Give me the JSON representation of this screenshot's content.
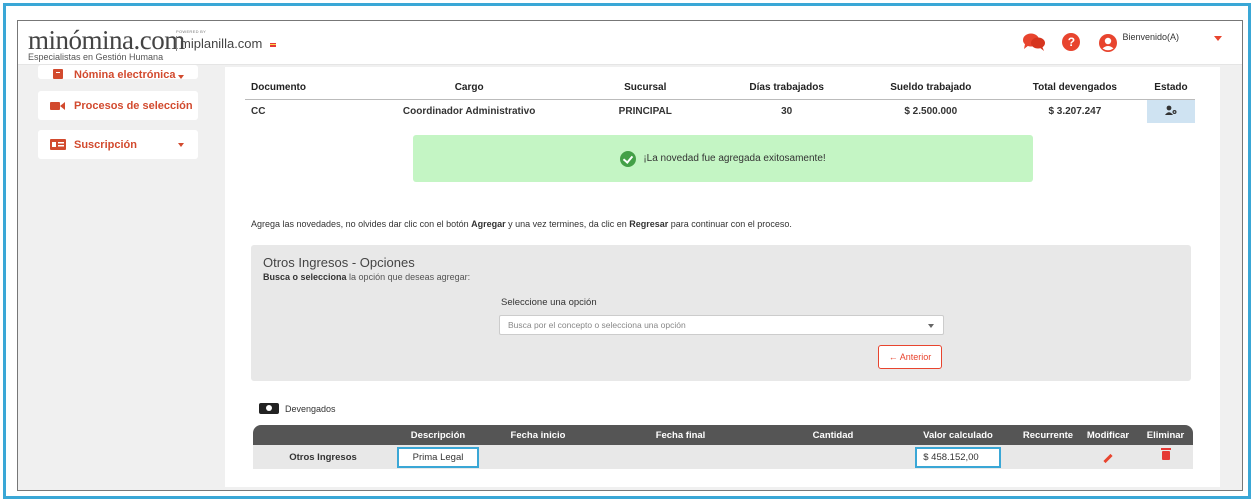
{
  "header": {
    "logo_text": "minómina.com",
    "logo_tagline": "Especialistas en Gestión Humana",
    "powered_by": "POWERED BY",
    "partner": "miplanilla.com",
    "welcome": "Bienvenido(A)",
    "help_symbol": "?",
    "icons": [
      "chat-icon",
      "help-icon",
      "user-icon",
      "chevron-down-icon"
    ]
  },
  "sidebar": {
    "items": [
      {
        "label": "Nómina electrónica",
        "icon": "document-icon",
        "has_dropdown": true
      },
      {
        "label": "Procesos de selección",
        "icon": "video-camera-icon",
        "has_dropdown": false
      },
      {
        "label": "Suscripción",
        "icon": "id-card-icon",
        "has_dropdown": true
      }
    ]
  },
  "employee_table": {
    "headers": [
      "Documento",
      "Cargo",
      "Sucursal",
      "Días trabajados",
      "Sueldo trabajado",
      "Total devengados",
      "Estado"
    ],
    "row": {
      "documento": "CC",
      "cargo": "Coordinador Administrativo",
      "sucursal": "PRINCIPAL",
      "dias": "30",
      "sueldo": "$ 2.500.000",
      "total": "$ 3.207.247",
      "estado_icon": "user-settings-icon"
    }
  },
  "alert": {
    "message": "¡La novedad fue agregada exitosamente!",
    "color": "#c4f5c4"
  },
  "instructions": {
    "part1": "Agrega las novedades, no olvides dar clic con el botón ",
    "bold1": "Agregar",
    "part2": " y una vez termines, da clic en ",
    "bold2": "Regresar",
    "part3": " para continuar con el proceso."
  },
  "options": {
    "title": "Otros Ingresos - Opciones",
    "sub_bold": "Busca o selecciona",
    "sub_rest": " la opción que deseas agregar:",
    "select_label": "Seleccione una opción",
    "select_placeholder": "Busca por el concepto o selecciona una opción",
    "prev_button": "← Anterior"
  },
  "devengados": {
    "label": "Devengados",
    "headers": [
      "",
      "Descripción",
      "Fecha inicio",
      "Fecha final",
      "Cantidad",
      "Valor calculado",
      "Recurrente",
      "Modificar",
      "Eliminar"
    ],
    "row": {
      "concepto": "Otros Ingresos",
      "descripcion": "Prima Legal",
      "fecha_inicio": "",
      "fecha_final": "",
      "cantidad": "",
      "valor": "$ 458.152,00",
      "recurrente": ""
    }
  },
  "colors": {
    "accent": "#e8442e",
    "highlight_border": "#3aa7d6",
    "table_header": "#555555"
  }
}
